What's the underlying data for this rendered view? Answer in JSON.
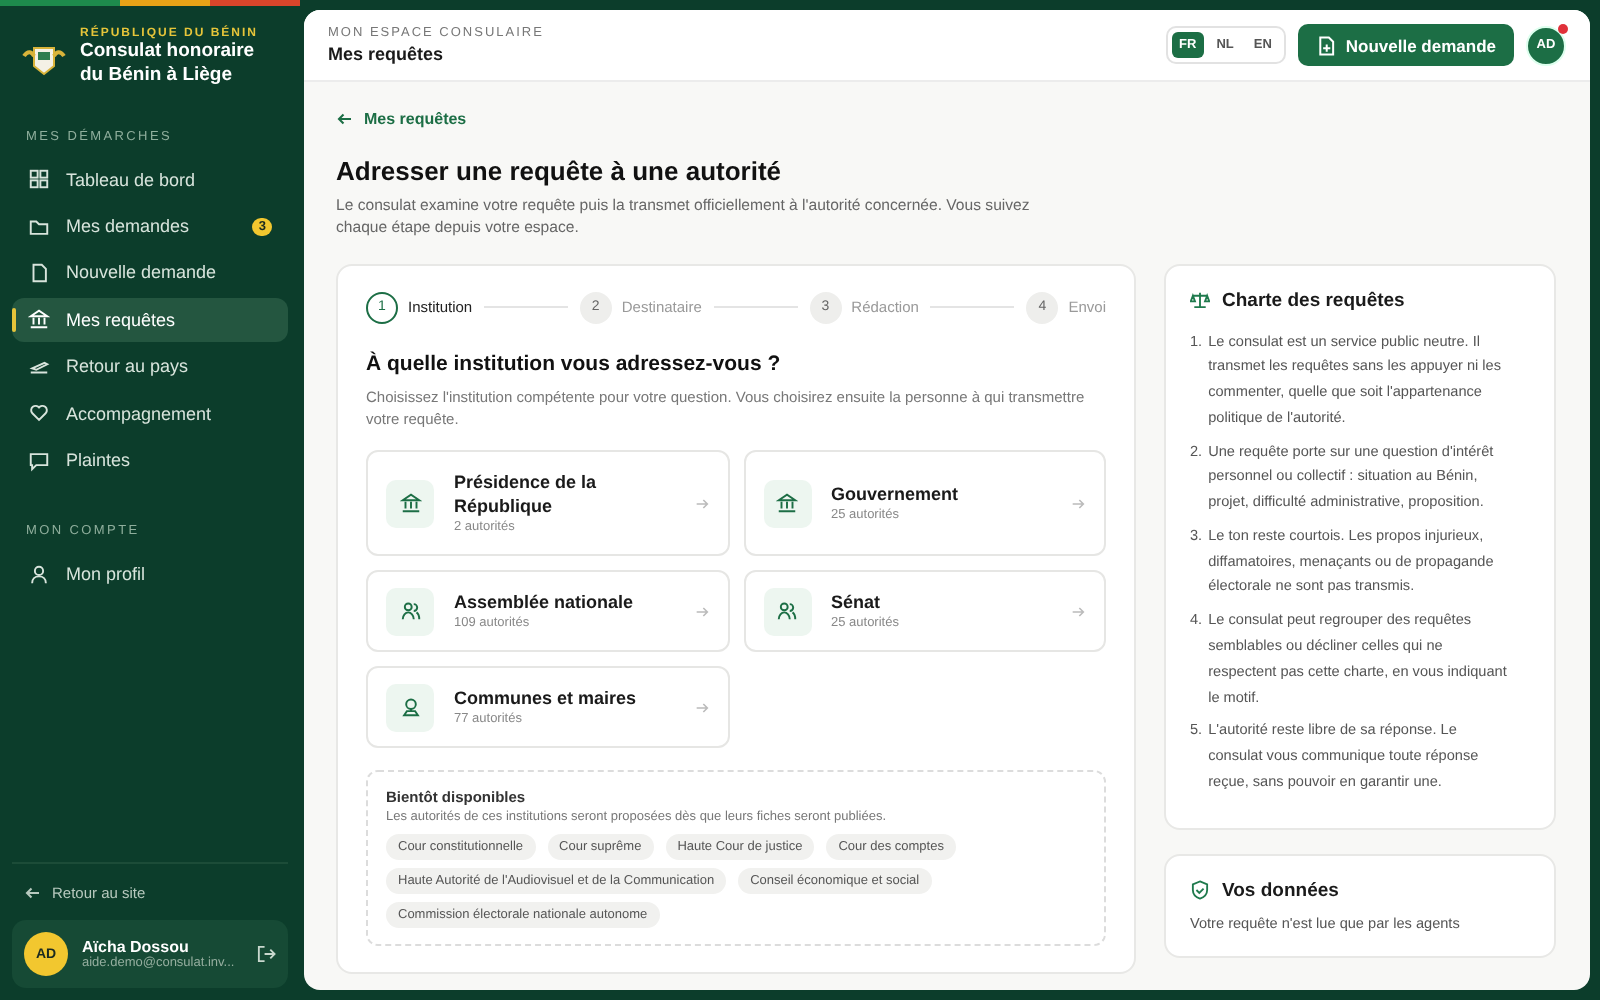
{
  "brand": {
    "overline": "RÉPUBLIQUE DU BÉNIN",
    "title": "Consulat honoraire du Bénin à Liège"
  },
  "sidebar": {
    "sections": [
      {
        "heading": "MES DÉMARCHES",
        "items": [
          {
            "label": "Tableau de bord",
            "kind": "grid",
            "selected": false
          },
          {
            "label": "Mes demandes",
            "kind": "folder",
            "selected": false,
            "badge": "3"
          },
          {
            "label": "Nouvelle demande",
            "kind": "file",
            "selected": false
          },
          {
            "label": "Mes requêtes",
            "kind": "bank",
            "selected": true
          },
          {
            "label": "Retour au pays",
            "kind": "plane",
            "selected": false
          },
          {
            "label": "Accompagnement",
            "kind": "heart",
            "selected": false
          },
          {
            "label": "Plaintes",
            "kind": "message",
            "selected": false
          }
        ]
      },
      {
        "heading": "MON COMPTE",
        "items": [
          {
            "label": "Mon profil",
            "kind": "user",
            "selected": false
          }
        ]
      }
    ],
    "back_link": "Retour au site",
    "user": {
      "initials": "AD",
      "name": "Aïcha Dossou",
      "email": "aide.demo@consulat.inv..."
    }
  },
  "header": {
    "overline": "MON ESPACE CONSULAIRE",
    "title": "Mes requêtes",
    "languages": [
      {
        "label": "FR",
        "selected": true
      },
      {
        "label": "NL",
        "selected": false
      },
      {
        "label": "EN",
        "selected": false
      }
    ],
    "new_button": "Nouvelle demande",
    "avatar": "AD",
    "notification": true
  },
  "breadcrumb": "Mes requêtes",
  "page_title": "Adresser une requête à une autorité",
  "intro": "Le consulat examine votre requête puis la transmet officiellement à l'autorité concernée. Vous suivez chaque étape depuis votre espace.",
  "stepper": [
    {
      "number": "1",
      "label": "Institution",
      "selected": true
    },
    {
      "number": "2",
      "label": "Destinataire",
      "selected": false
    },
    {
      "number": "3",
      "label": "Rédaction",
      "selected": false
    },
    {
      "number": "4",
      "label": "Envoi",
      "selected": false
    }
  ],
  "question": "À quelle institution vous adressez-vous ?",
  "hint": "Choisissez l'institution compétente pour votre question. Vous choisirez ensuite la personne à qui transmettre votre requête.",
  "institutions": [
    {
      "name": "Présidence de la République",
      "count": "2 autorités",
      "kind": "building"
    },
    {
      "name": "Gouvernement",
      "count": "25 autorités",
      "kind": "building"
    },
    {
      "name": "Assemblée nationale",
      "count": "109 autorités",
      "kind": "people"
    },
    {
      "name": "Sénat",
      "count": "25 autorités",
      "kind": "people"
    },
    {
      "name": "Communes et maires",
      "count": "77 autorités",
      "kind": "pin"
    }
  ],
  "upcoming": {
    "title": "Bientôt disponibles",
    "text": "Les autorités de ces institutions seront proposées dès que leurs fiches seront publiées.",
    "tags": [
      "Cour constitutionnelle",
      "Cour suprême",
      "Haute Cour de justice",
      "Cour des comptes",
      "Haute Autorité de l'Audiovisuel et de la Communication",
      "Conseil économique et social",
      "Commission électorale nationale autonome"
    ]
  },
  "charter": {
    "title": "Charte des requêtes",
    "items": [
      {
        "number": "1.",
        "text": "Le consulat est un service public neutre. Il transmet les requêtes sans les appuyer ni les commenter, quelle que soit l'appartenance politique de l'autorité."
      },
      {
        "number": "2.",
        "text": "Une requête porte sur une question d'intérêt personnel ou collectif : situation au Bénin, projet, difficulté administrative, proposition."
      },
      {
        "number": "3.",
        "text": "Le ton reste courtois. Les propos injurieux, diffamatoires, menaçants ou de propagande électorale ne sont pas transmis."
      },
      {
        "number": "4.",
        "text": "Le consulat peut regrouper des requêtes semblables ou décliner celles qui ne respectent pas cette charte, en vous indiquant le motif."
      },
      {
        "number": "5.",
        "text": "L'autorité reste libre de sa réponse. Le consulat vous communique toute réponse reçue, sans pouvoir en garantir une."
      }
    ]
  },
  "data_card": {
    "title": "Vos données",
    "text": "Votre requête n'est lue que par les agents"
  }
}
